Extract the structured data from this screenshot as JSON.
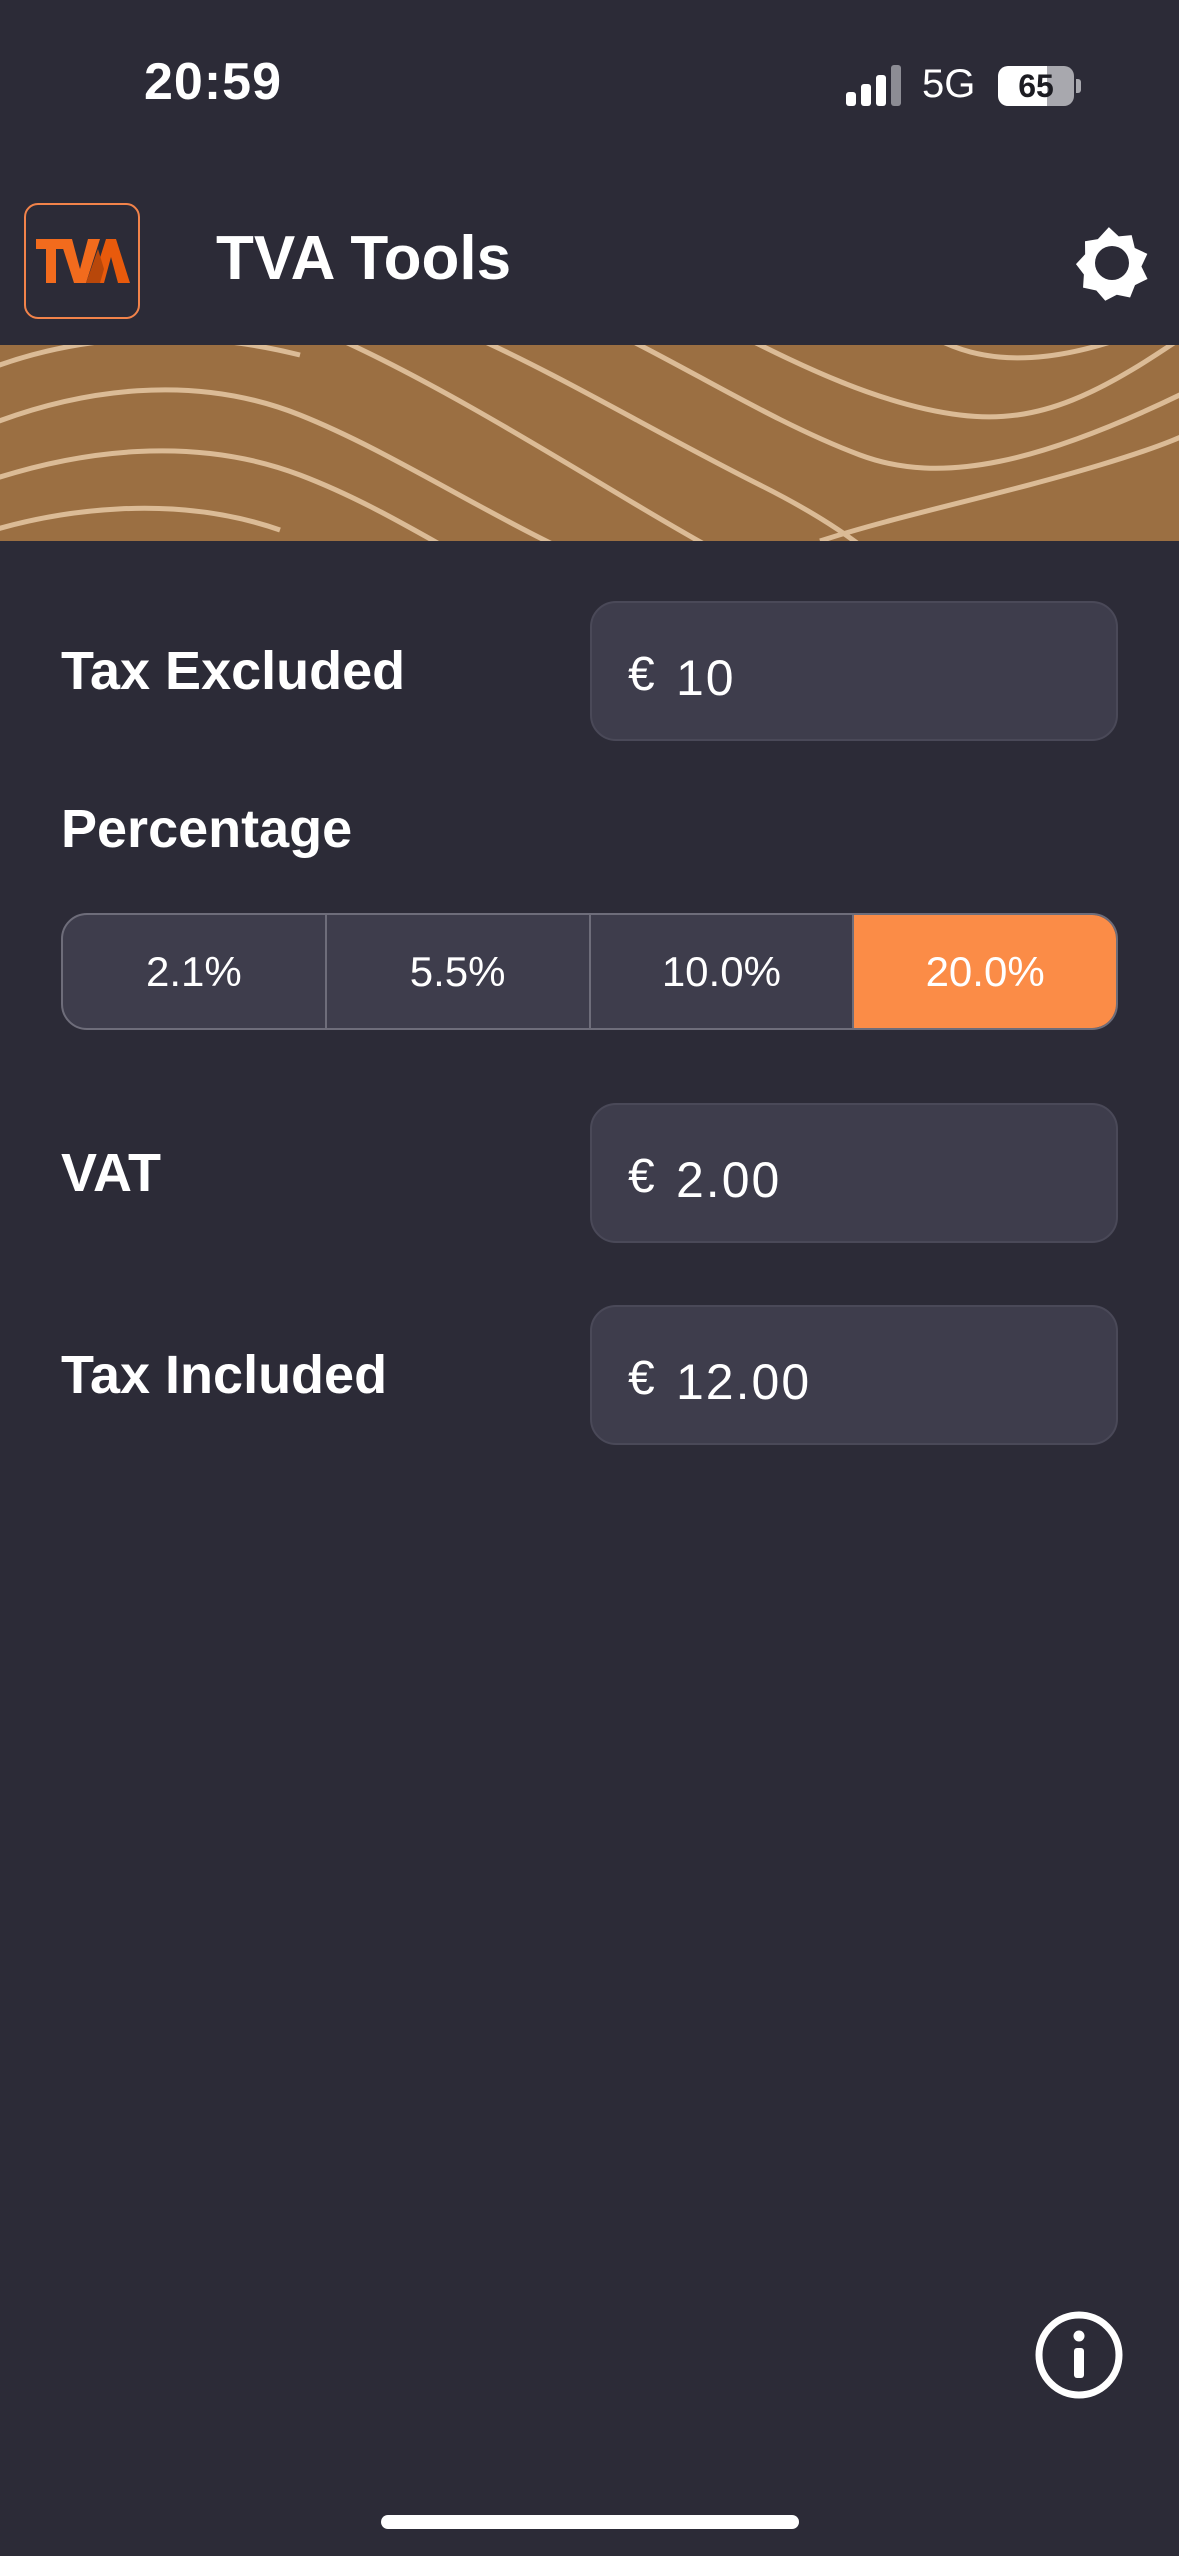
{
  "status_bar": {
    "time": "20:59",
    "network": "5G",
    "battery_level": "65",
    "icons": [
      "signal-icon",
      "battery-icon"
    ]
  },
  "header": {
    "logo_text": "TVA",
    "title": "TVA Tools",
    "settings_icon": "gear-icon"
  },
  "form": {
    "tax_excluded": {
      "label": "Tax Excluded",
      "currency": "€",
      "value": "10"
    },
    "percentage": {
      "label": "Percentage",
      "options": [
        "2.1%",
        "5.5%",
        "10.0%",
        "20.0%"
      ],
      "selected": "20.0%"
    },
    "vat": {
      "label": "VAT",
      "currency": "€",
      "value": "2.00"
    },
    "tax_included": {
      "label": "Tax Included",
      "currency": "€",
      "value": "12.00"
    }
  },
  "footer": {
    "info_icon": "info-icon"
  },
  "colors": {
    "background": "#2c2b37",
    "field_background": "#3e3d4c",
    "accent": "#fb8c47",
    "logo_orange": "#f2834a",
    "banner": "#9b6f42",
    "banner_lines": "#e2c4a0"
  }
}
